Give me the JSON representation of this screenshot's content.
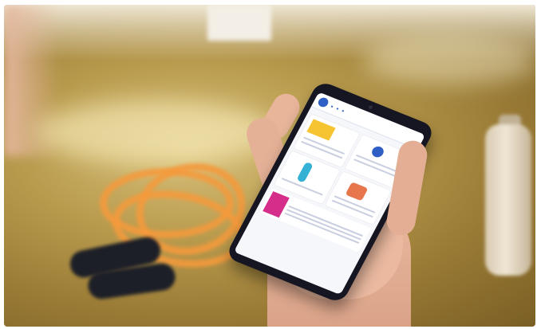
{
  "photo": {
    "description_items": [
      "orange-jump-rope",
      "black-rope-handles",
      "glass-bottle",
      "hand-holding-phone"
    ]
  },
  "phone_screen": {
    "nav": [],
    "breadcrumb": "",
    "page_title": "",
    "banner_title": ""
  }
}
